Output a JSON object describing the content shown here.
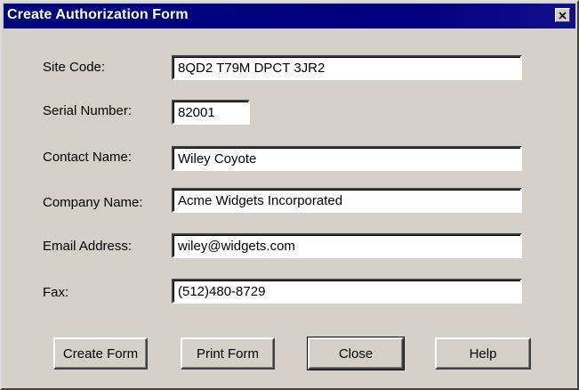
{
  "window": {
    "title": "Create Authorization Form",
    "close_icon": "close-icon"
  },
  "form": {
    "site_code": {
      "label": "Site Code:",
      "value": "8QD2 T79M DPCT 3JR2"
    },
    "serial_number": {
      "label": "Serial Number:",
      "value": "82001"
    },
    "contact_name": {
      "label": "Contact Name:",
      "value": "Wiley Coyote"
    },
    "company_name": {
      "label": "Company Name:",
      "value": "Acme Widgets Incorporated"
    },
    "email_address": {
      "label": "Email Address:",
      "value": "wiley@widgets.com"
    },
    "fax": {
      "label": "Fax:",
      "value": "(512)480-8729"
    }
  },
  "buttons": {
    "create_form": "Create Form",
    "print_form": "Print Form",
    "close": "Close",
    "help": "Help"
  },
  "colors": {
    "titlebar": "#000080",
    "face": "#d4d0c8",
    "title_text": "#ffffff"
  }
}
